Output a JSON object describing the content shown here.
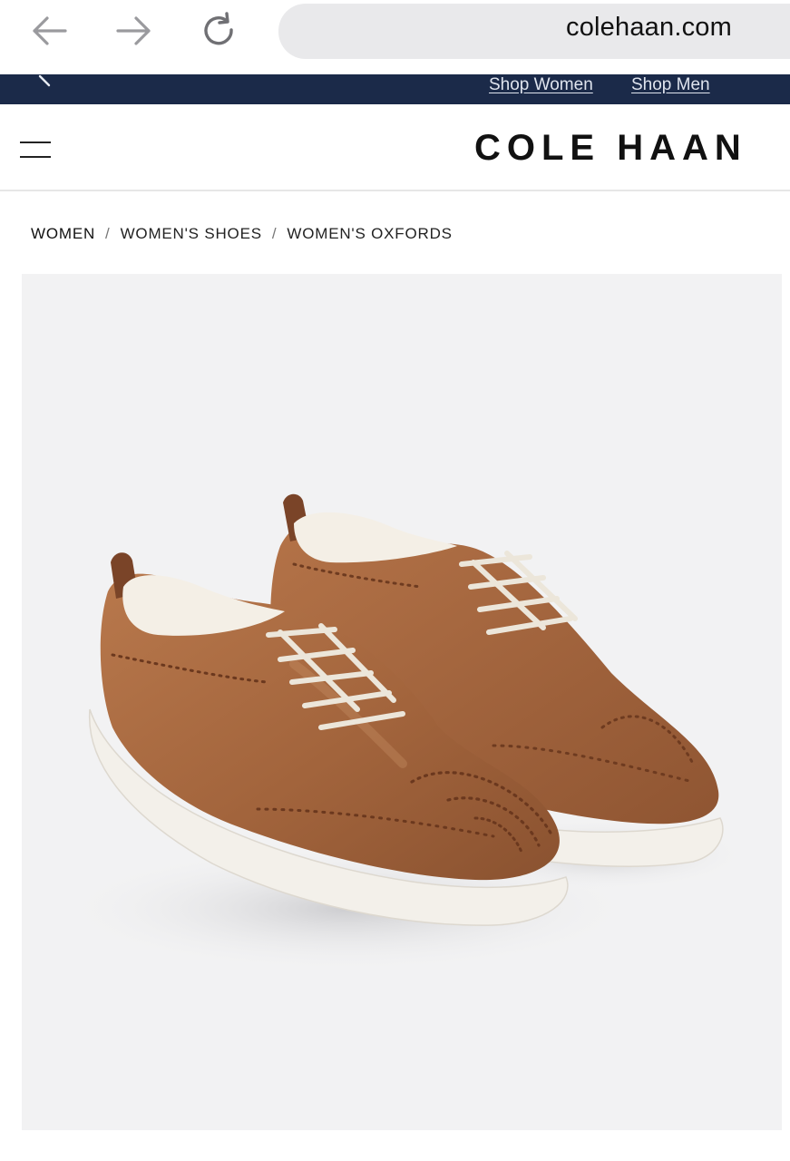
{
  "browser": {
    "url": "colehaan.com",
    "back_icon": "arrow-left-icon",
    "forward_icon": "arrow-right-icon",
    "reload_icon": "reload-icon"
  },
  "promo": {
    "links": [
      "Shop Women",
      "Shop Men"
    ]
  },
  "header": {
    "logo": "COLE HAAN",
    "menu_icon": "hamburger-menu-icon"
  },
  "breadcrumb": {
    "items": [
      "WOMEN",
      "WOMEN'S SHOES",
      "WOMEN'S OXFORDS"
    ],
    "separator": "/"
  },
  "product": {
    "image": "product-photo"
  },
  "colors": {
    "promo_bg": "#1b2a49",
    "image_bg": "#f2f2f3",
    "leather": "#a2643c",
    "sole": "#f3f0ea"
  }
}
